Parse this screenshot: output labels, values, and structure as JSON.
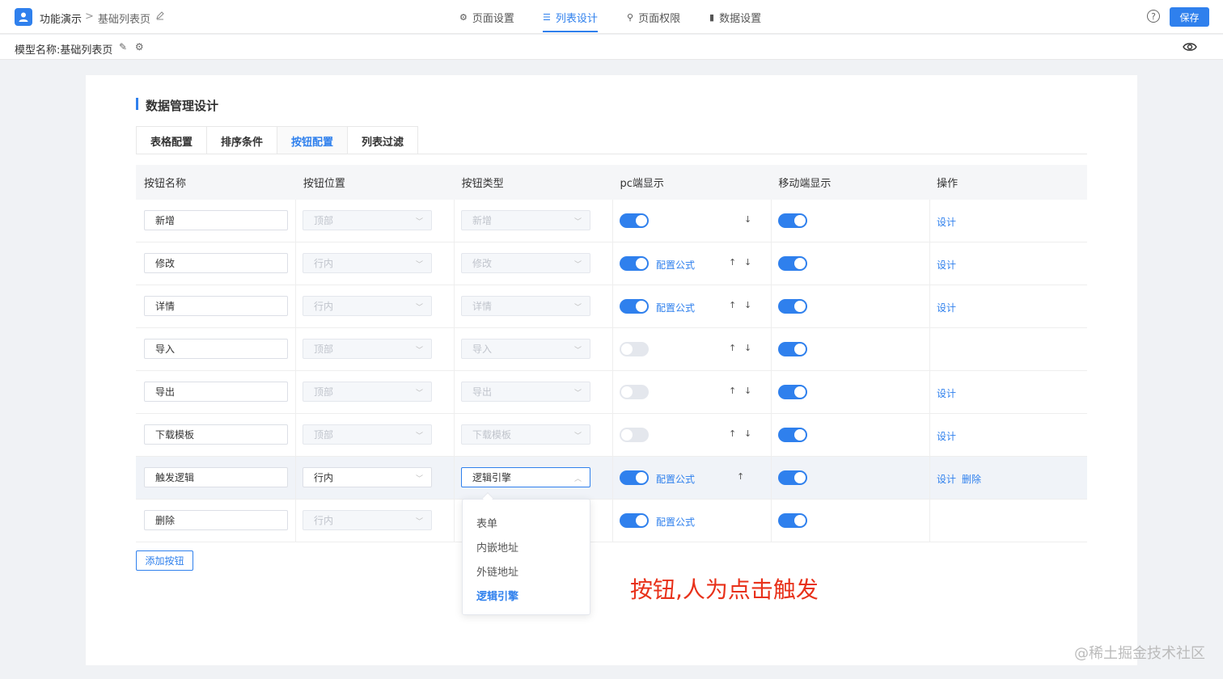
{
  "header": {
    "app_name": "功能演示",
    "separator": ">",
    "page_name": "基础列表页",
    "nav": [
      {
        "label": "页面设置",
        "icon": "gear-icon"
      },
      {
        "label": "列表设计",
        "icon": "list-icon"
      },
      {
        "label": "页面权限",
        "icon": "lock-icon"
      },
      {
        "label": "数据设置",
        "icon": "bar-chart-icon"
      }
    ],
    "help": "?",
    "save_label": "保存"
  },
  "model_bar": {
    "label": "模型名称:基础列表页"
  },
  "section": {
    "title": "数据管理设计",
    "tabs": [
      "表格配置",
      "排序条件",
      "按钮配置",
      "列表过滤"
    ],
    "active_tab": "按钮配置"
  },
  "table": {
    "headers": [
      "按钮名称",
      "按钮位置",
      "按钮类型",
      "pc端显示",
      "移动端显示",
      "操作"
    ],
    "rows": [
      {
        "name": "新增",
        "position": "顶部",
        "type": "新增",
        "pc": true,
        "formula": "",
        "arrows": "down",
        "mobile": true,
        "design": "设计",
        "delete": ""
      },
      {
        "name": "修改",
        "position": "行内",
        "type": "修改",
        "pc": true,
        "formula": "配置公式",
        "arrows": "both",
        "mobile": true,
        "design": "设计",
        "delete": ""
      },
      {
        "name": "详情",
        "position": "行内",
        "type": "详情",
        "pc": true,
        "formula": "配置公式",
        "arrows": "both",
        "mobile": true,
        "design": "设计",
        "delete": ""
      },
      {
        "name": "导入",
        "position": "顶部",
        "type": "导入",
        "pc": false,
        "formula": "",
        "arrows": "both",
        "mobile": true,
        "design": "",
        "delete": ""
      },
      {
        "name": "导出",
        "position": "顶部",
        "type": "导出",
        "pc": false,
        "formula": "",
        "arrows": "both",
        "mobile": true,
        "design": "设计",
        "delete": ""
      },
      {
        "name": "下载模板",
        "position": "顶部",
        "type": "下载模板",
        "pc": false,
        "formula": "",
        "arrows": "both",
        "mobile": true,
        "design": "设计",
        "delete": ""
      },
      {
        "name": "触发逻辑",
        "position": "行内",
        "type": "逻辑引擎",
        "pc": true,
        "formula": "配置公式",
        "arrows": "up",
        "mobile": true,
        "design": "设计",
        "delete": "删除"
      },
      {
        "name": "删除",
        "position": "行内",
        "type": "",
        "pc": true,
        "formula": "配置公式",
        "arrows": "",
        "mobile": true,
        "design": "",
        "delete": ""
      }
    ],
    "arrow_up": "↑",
    "arrow_down": "↓",
    "add_button": "添加按钮"
  },
  "dropdown": {
    "options": [
      "表单",
      "内嵌地址",
      "外链地址",
      "逻辑引擎"
    ],
    "selected": "逻辑引擎"
  },
  "annotation": "按钮,人为点击触发",
  "watermark": "@稀土掘金技术社区",
  "colors": {
    "accent": "#2f80ed",
    "annotation": "#e8311a"
  }
}
